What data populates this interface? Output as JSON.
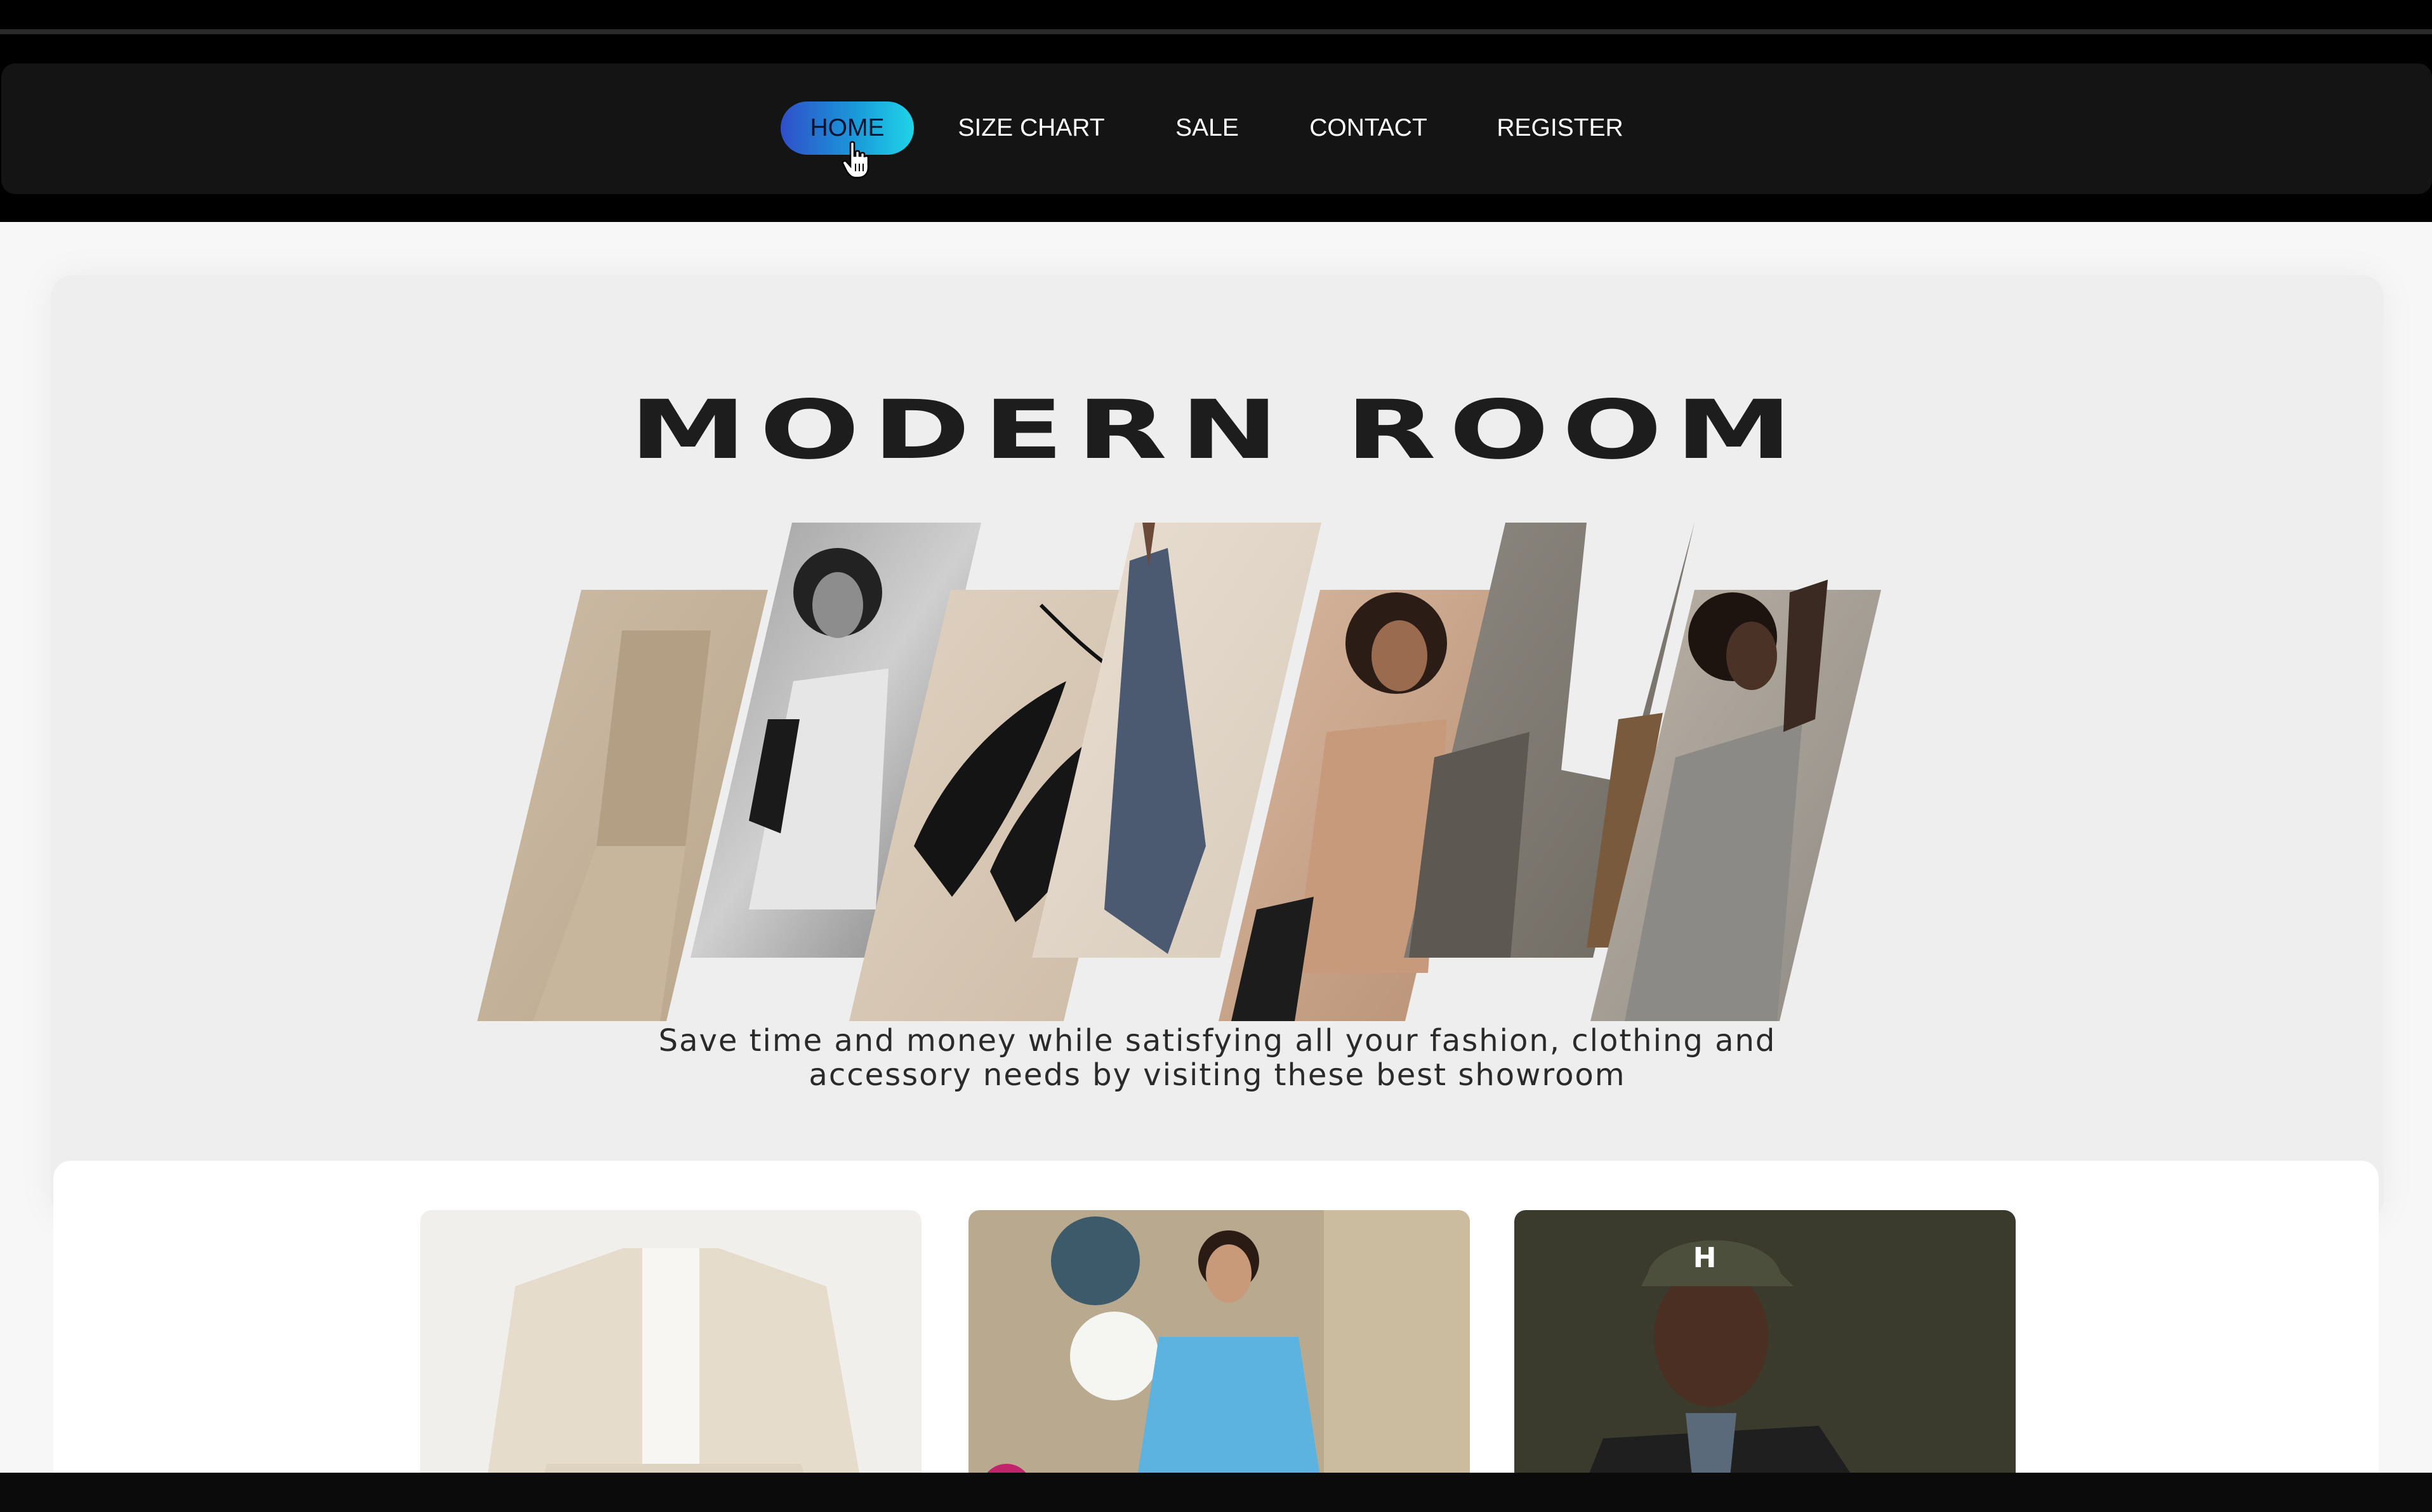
{
  "nav": {
    "items": [
      {
        "label": "HOME",
        "active": true
      },
      {
        "label": "SIZE CHART",
        "active": false
      },
      {
        "label": "SALE",
        "active": false
      },
      {
        "label": "CONTACT",
        "active": false
      },
      {
        "label": "REGISTER",
        "active": false
      }
    ]
  },
  "hero": {
    "title": "MODERN ROOM",
    "tagline_line1": "Save time and money while satisfying all your fashion, clothing and",
    "tagline_line2": "accessory needs by visiting these best showroom"
  },
  "collage": {
    "panels": [
      "beige-shirt-man",
      "woman-trench-coat-bw",
      "black-heels",
      "blue-jacket-hanging",
      "woman-tan-blouse",
      "folded-fabric",
      "man-grey-shirt"
    ]
  },
  "cards": [
    {
      "image": "cream-jacket-model"
    },
    {
      "image": "woman-blue-dress-flowers"
    },
    {
      "image": "smiling-man-cap"
    }
  ],
  "colors": {
    "nav_bg": "#141414",
    "active_gradient_start": "#2f4fc9",
    "active_gradient_end": "#1fd4e8",
    "page_bg": "#f7f7f7"
  }
}
